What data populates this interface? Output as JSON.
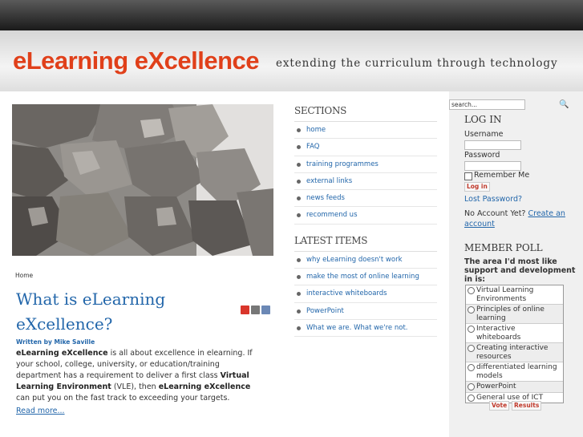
{
  "header": {
    "logo": "eLearning eXcellence",
    "tagline": "extending the curriculum through technology"
  },
  "article": {
    "breadcrumb": "Home",
    "title": "What is eLearning eXcellence?",
    "author": "Written by Mike Saville",
    "intro": {
      "p1_bold": "eLearning eXcellence",
      "p1_text": " is all about excellence in elearning. If your school, college, university, or education/training department has a requirement to deliver a first class ",
      "p2_bold": "Virtual Learning Environment",
      "p2_text": " (VLE), then ",
      "p3_bold": "eLearning eXcellence",
      "p3_text": " can put you on the fast track to exceeding your targets."
    },
    "read_more": "Read more..."
  },
  "sections": {
    "title": "SECTIONS",
    "items": [
      "home",
      "FAQ",
      "training programmes",
      "external links",
      "news feeds",
      "recommend us"
    ]
  },
  "latest": {
    "title": "LATEST ITEMS",
    "items": [
      "why eLearning doesn't work",
      "make the most of online learning",
      "interactive whiteboards",
      "PowerPoint",
      "What we are. What we're not."
    ]
  },
  "search": {
    "placeholder": "search..."
  },
  "login": {
    "title": "LOG IN",
    "username_label": "Username",
    "password_label": "Password",
    "remember_label": "Remember Me",
    "login_button": "Log in",
    "lost_password": "Lost Password?",
    "no_account": "No Account Yet?",
    "create_account": "Create an account"
  },
  "poll": {
    "title": "MEMBER POLL",
    "question": "The area I'd most like support and development in is:",
    "options": [
      "Virtual Learning Environments",
      "Principles of online learning",
      "Interactive whiteboards",
      "Creating interactive resources",
      "differentiated learning models",
      "PowerPoint",
      "General use of ICT"
    ],
    "vote_button": "Vote",
    "results_button": "Results"
  },
  "colors": {
    "logo": "#e0401a",
    "link": "#2266aa",
    "accent": "#c0392b"
  },
  "icons": [
    "pdf-icon",
    "print-icon",
    "email-icon",
    "search-icon"
  ]
}
